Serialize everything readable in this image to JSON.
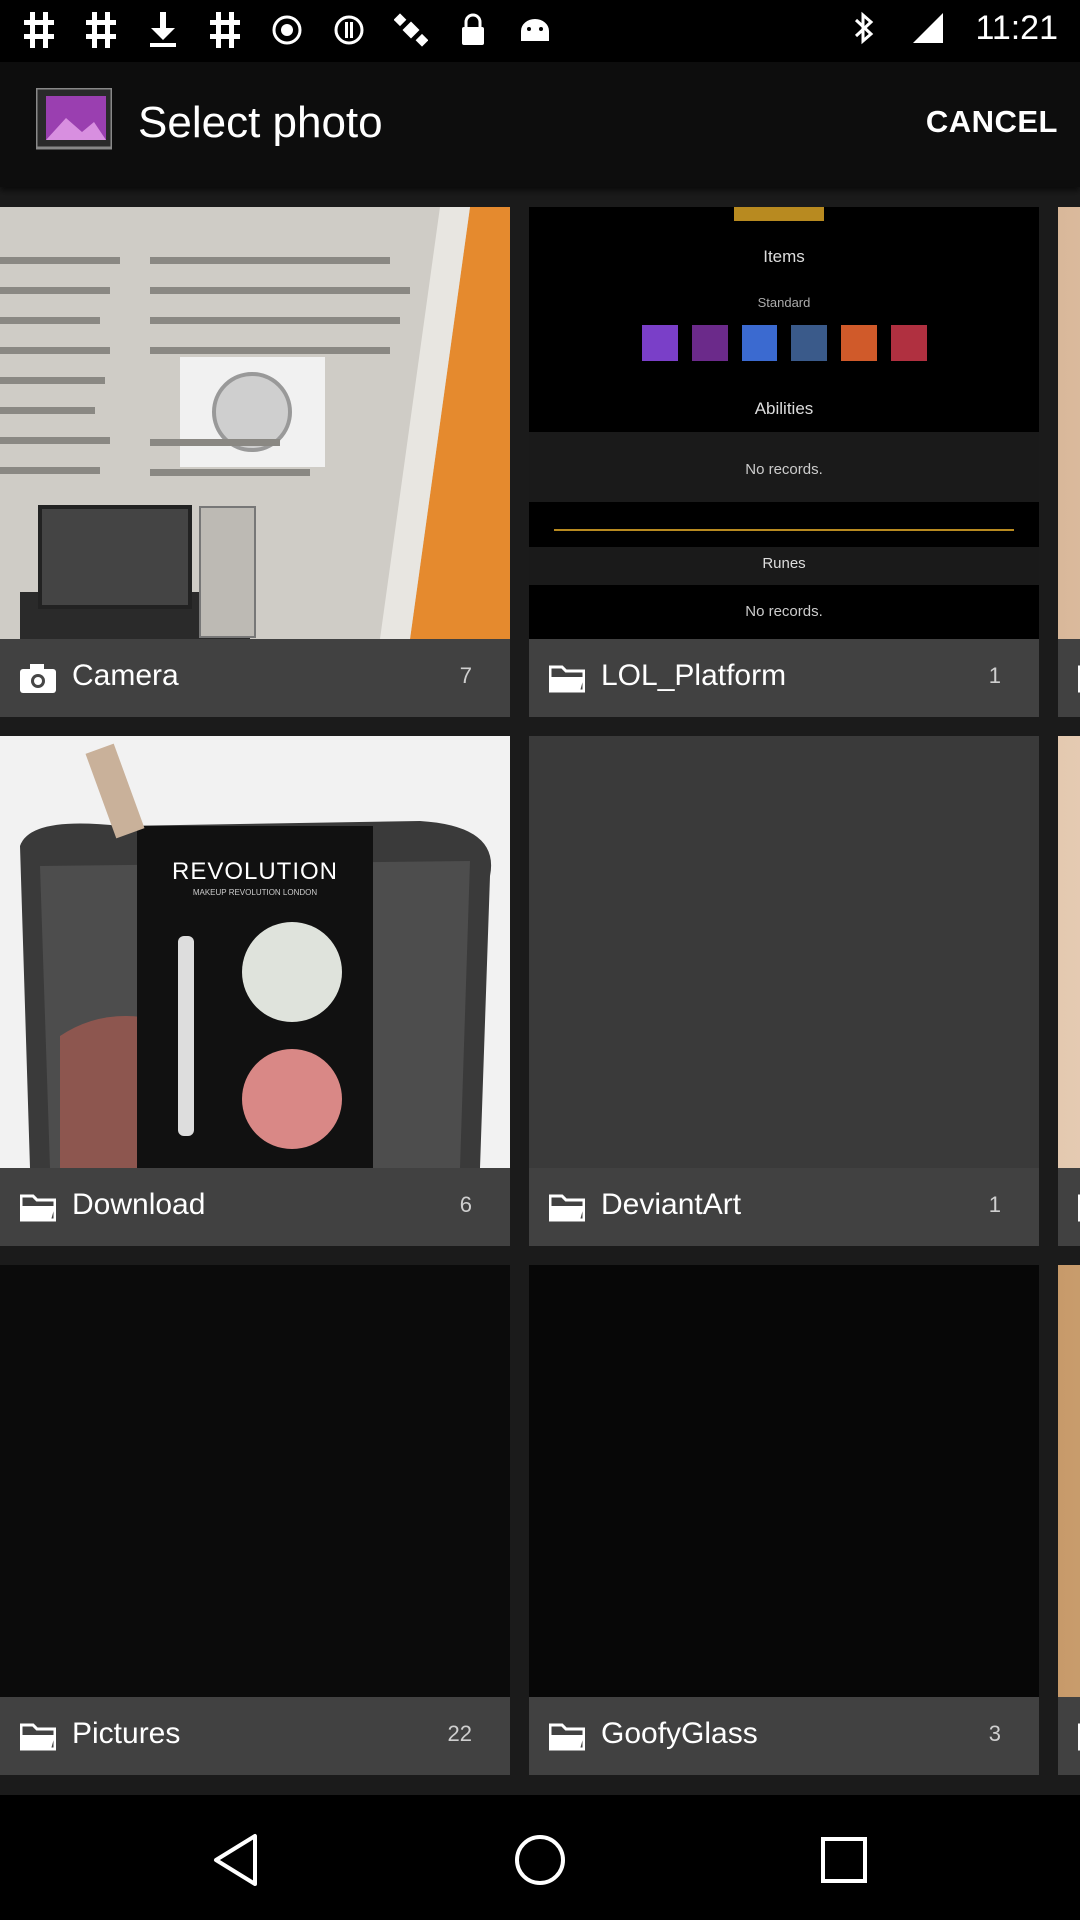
{
  "status_bar": {
    "time": "11:21",
    "left_icons": [
      "notification-icon",
      "notification-icon",
      "download-icon",
      "notification-icon",
      "record-icon",
      "alert-icon",
      "satellite-icon",
      "lock-icon",
      "android-icon"
    ],
    "right_icons": [
      "bluetooth-icon",
      "signal-icon"
    ]
  },
  "app_bar": {
    "title": "Select photo",
    "cancel_label": "CANCEL"
  },
  "albums": [
    {
      "name": "Camera",
      "count": "7",
      "icon": "camera-icon"
    },
    {
      "name": "LOL_Platform",
      "count": "1",
      "icon": "folder-icon"
    },
    {
      "name": "",
      "count": "",
      "icon": "folder-icon"
    },
    {
      "name": "Download",
      "count": "6",
      "icon": "folder-icon"
    },
    {
      "name": "DeviantArt",
      "count": "1",
      "icon": "folder-icon"
    },
    {
      "name": "",
      "count": "",
      "icon": "folder-icon"
    },
    {
      "name": "Pictures",
      "count": "22",
      "icon": "folder-icon"
    },
    {
      "name": "GoofyGlass",
      "count": "3",
      "icon": "folder-icon"
    },
    {
      "name": "",
      "count": "",
      "icon": "folder-icon"
    }
  ],
  "thumb_text": {
    "lol": {
      "items": "Items",
      "standard": "Standard",
      "abilities": "Abilities",
      "no_records": "No records.",
      "runes": "Runes",
      "no_records_2": "No records."
    },
    "revolution": {
      "brand": "REVOLUTION",
      "sub": "MAKEUP REVOLUTION LONDON"
    }
  },
  "colors": {
    "caption_bg": "#464646",
    "app_bar_bg": "#0d0d0d",
    "status_bar_bg": "#000000"
  },
  "nav_bar": [
    "back-icon",
    "home-icon",
    "recents-icon"
  ]
}
